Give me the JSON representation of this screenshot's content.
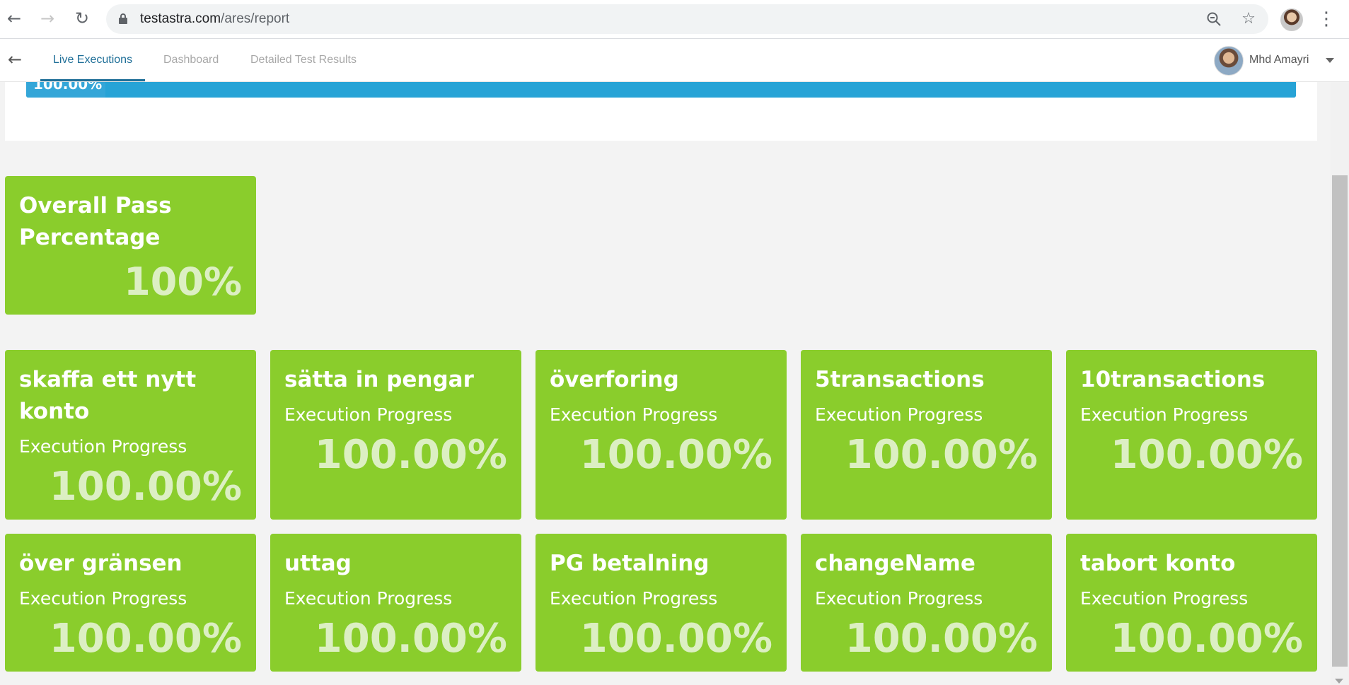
{
  "browser": {
    "url_host": "testastra.com",
    "url_path": "/ares/report",
    "back_icon": "arrow-left-icon",
    "forward_icon": "arrow-right-icon",
    "reload_icon": "reload-icon",
    "zoom_icon": "zoom-out-icon",
    "bookmark_icon": "star-icon",
    "menu_icon": "kebab-menu-icon"
  },
  "header": {
    "tabs": [
      {
        "label": "Live Executions",
        "active": true
      },
      {
        "label": "Dashboard",
        "active": false
      },
      {
        "label": "Detailed Test Results",
        "active": false
      }
    ],
    "user_name": "Mhd Amayri"
  },
  "progress": {
    "label": "100.00%",
    "value": 1.0
  },
  "summary": {
    "title": "Overall Pass Percentage",
    "value": "100%"
  },
  "tests": [
    {
      "name": "skaffa ett nytt konto",
      "subtitle": "Execution Progress",
      "value": "100.00%"
    },
    {
      "name": "sätta in pengar",
      "subtitle": "Execution Progress",
      "value": "100.00%"
    },
    {
      "name": "överforing",
      "subtitle": "Execution Progress",
      "value": "100.00%"
    },
    {
      "name": "5transactions",
      "subtitle": "Execution Progress",
      "value": "100.00%"
    },
    {
      "name": "10transactions",
      "subtitle": "Execution Progress",
      "value": "100.00%"
    },
    {
      "name": "över gränsen",
      "subtitle": "Execution Progress",
      "value": "100.00%"
    },
    {
      "name": "uttag",
      "subtitle": "Execution Progress",
      "value": "100.00%"
    },
    {
      "name": "PG betalning",
      "subtitle": "Execution Progress",
      "value": "100.00%"
    },
    {
      "name": "changeName",
      "subtitle": "Execution Progress",
      "value": "100.00%"
    },
    {
      "name": "tabort konto",
      "subtitle": "Execution Progress",
      "value": "100.00%"
    }
  ],
  "colors": {
    "tile": "#8acd2c",
    "tile_value": "#dcefc3",
    "progress_bar": "#20afd4",
    "active_tab": "#1f6f98"
  }
}
